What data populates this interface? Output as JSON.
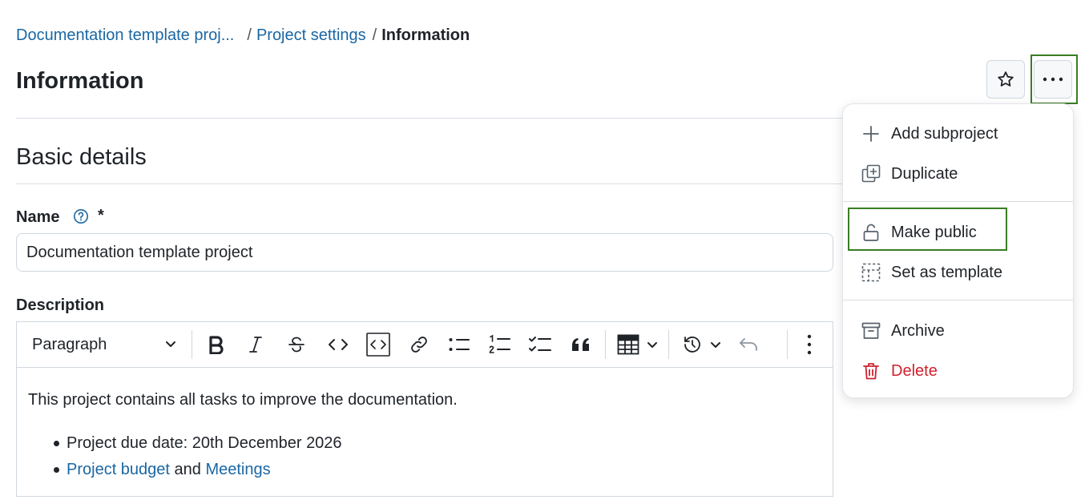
{
  "breadcrumb": {
    "project": "Documentation template proj...",
    "settings": "Project settings",
    "current": "Information",
    "sep": "/"
  },
  "page_title": "Information",
  "section_title": "Basic details",
  "name_field": {
    "label": "Name",
    "required_marker": "*",
    "value": "Documentation template project"
  },
  "description_field": {
    "label": "Description",
    "toolbar": {
      "paragraph_select": "Paragraph",
      "buttons": [
        "bold-icon",
        "italic-icon",
        "strikethrough-icon",
        "inline-code-icon",
        "code-block-icon",
        "link-icon",
        "bulleted-list-icon",
        "numbered-list-icon",
        "task-list-icon",
        "quote-icon",
        "table-icon",
        "history-icon",
        "undo-icon",
        "more-vertical-icon"
      ]
    },
    "content": {
      "paragraph": "This project contains all tasks to improve the documentation.",
      "bullet1": "Project due date: 20th December 2026",
      "bullet2_link1": "Project budget",
      "bullet2_text": " and ",
      "bullet2_link2": "Meetings"
    }
  },
  "menu": {
    "add_subproject": "Add subproject",
    "duplicate": "Duplicate",
    "make_public": "Make public",
    "set_as_template": "Set as template",
    "archive": "Archive",
    "delete": "Delete"
  },
  "colors": {
    "link": "#1a67a3",
    "highlight": "#3a7d23",
    "danger": "#cf222e",
    "border": "#d0d7de"
  }
}
